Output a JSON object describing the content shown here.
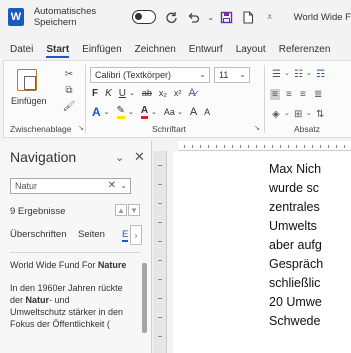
{
  "titlebar": {
    "app_letter": "W",
    "autosave_label": "Automatisches Speichern",
    "doc_title": "World Wide F"
  },
  "menu": {
    "tabs": [
      "Datei",
      "Start",
      "Einfügen",
      "Zeichnen",
      "Entwurf",
      "Layout",
      "Referenzen"
    ],
    "active": "Start"
  },
  "ribbon": {
    "clipboard": {
      "paste_label": "Einfügen",
      "group_label": "Zwischenablage"
    },
    "font": {
      "font_name": "Calibri (Textkörper)",
      "font_size": "11",
      "bold": "F",
      "italic": "K",
      "underline": "U",
      "strike": "ab",
      "subscript": "x₂",
      "superscript": "x²",
      "grow": "A",
      "shrink": "A",
      "case": "Aa",
      "group_label": "Schriftart"
    },
    "paragraph": {
      "group_label": "Absatz"
    }
  },
  "navigation": {
    "title": "Navigation",
    "search_value": "Natur",
    "result_count": "9 Ergebnisse",
    "tabs": [
      "Überschriften",
      "Seiten",
      "E"
    ],
    "results": [
      {
        "pre": "World Wide Fund For ",
        "bold": "Nature",
        "post": ""
      },
      {
        "pre": "In den 1960er Jahren rückte der ",
        "bold": "Natur",
        "post": "- und Umweltschutz stärker in den Fokus der Öffentlichkeit ("
      }
    ]
  },
  "document": {
    "lines": [
      "Max Nich",
      "wurde sc",
      "zentrales",
      "Umwelts",
      "aber aufg",
      "Gespräch",
      "schließlic",
      "20 Umwe",
      "Schwede"
    ]
  }
}
